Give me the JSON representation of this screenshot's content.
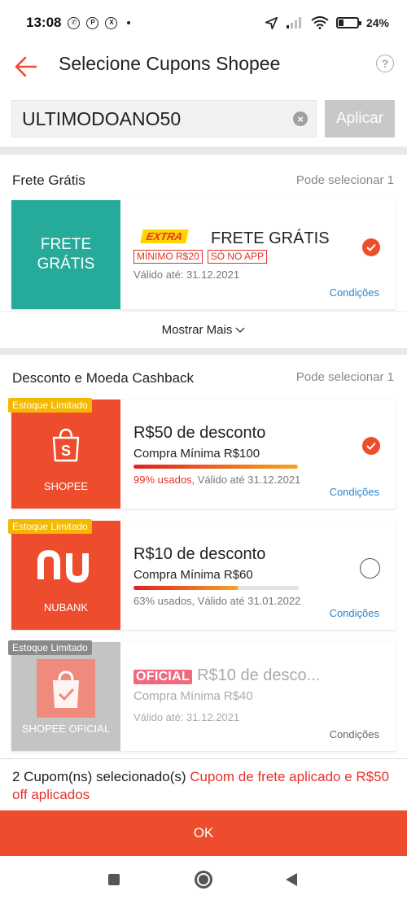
{
  "status_bar": {
    "time": "13:08",
    "battery": "24%"
  },
  "header": {
    "title": "Selecione Cupons Shopee"
  },
  "search": {
    "code_value": "ULTIMODOANO50",
    "apply_label": "Aplicar"
  },
  "free_shipping": {
    "section_title": "Frete Grátis",
    "section_note": "Pode selecionar 1",
    "coupon": {
      "stub_line1": "FRETE",
      "stub_line2": "GRÁTIS",
      "logo_text": "EXTRA",
      "title": "FRETE GRÁTIS",
      "badges": [
        "MÍNIMO R$20",
        "SÓ NO APP"
      ],
      "valid": "Válido até: 31.12.2021",
      "conditions": "Condições",
      "selected": true
    },
    "show_more": "Mostrar Mais"
  },
  "discount": {
    "section_title": "Desconto e Moeda Cashback",
    "section_note": "Pode selecionar 1",
    "coupons": [
      {
        "tag": "Estoque Limitado",
        "stub_label": "SHOPEE",
        "title": "R$50 de desconto",
        "min": "Compra Mínima R$100",
        "progress": 0.99,
        "used": "99% usados,",
        "valid": " Válido até 31.12.2021",
        "conditions": "Condições",
        "selected": true
      },
      {
        "tag": "Estoque Limitado",
        "stub_label": "NUBANK",
        "title": "R$10 de desconto",
        "min": "Compra Mínima R$60",
        "progress": 0.63,
        "used": "63% usados,",
        "valid": " Válido até 31.01.2022",
        "conditions": "Condições",
        "selected": false
      },
      {
        "tag": "Estoque Limitado",
        "stub_label": "SHOPEE OFICIAL",
        "logo_text": "OFICIAL",
        "title": "R$10 de desco...",
        "min": "Compra Mínima R$40",
        "valid": "Válido até: 31.12.2021",
        "conditions": "Condições",
        "disabled": true
      }
    ]
  },
  "footer": {
    "count_text": "2 Cupom(ns) selecionado(s)",
    "highlight_text": "Cupom de frete aplicado e R$50 off aplicados",
    "ok_label": "OK"
  },
  "colors": {
    "brand": "#ee4d2d",
    "teal": "#26aa99",
    "link": "#2a86c9",
    "tag_yellow": "#f5b800",
    "disabled": "#c4c4c4"
  },
  "icons": [
    "back-arrow-icon",
    "help-icon",
    "clear-icon",
    "check-icon",
    "chevron-down-icon",
    "shopee-bag-icon",
    "nubank-logo-icon"
  ]
}
